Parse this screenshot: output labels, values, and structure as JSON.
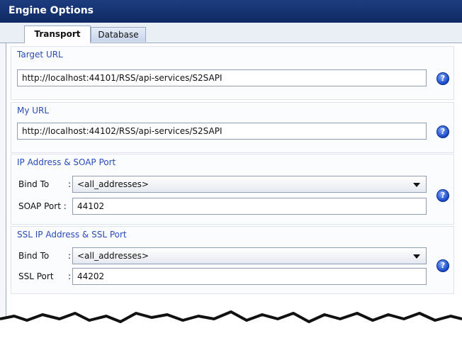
{
  "window": {
    "title": "Engine Options"
  },
  "tabs": [
    {
      "label": "Transport",
      "active": true
    },
    {
      "label": "Database",
      "active": false
    }
  ],
  "groups": {
    "target": {
      "label": "Target URL",
      "url_value": "http://localhost:44101/RSS/api-services/S2SAPI"
    },
    "my": {
      "label": "My URL",
      "url_value": "http://localhost:44102/RSS/api-services/S2SAPI"
    },
    "ip": {
      "label": "IP Address & SOAP Port",
      "bind_label": "Bind To",
      "bind_sep": ":",
      "bind_value": "<all_addresses>",
      "port_label": "SOAP Port :",
      "port_value": "44102"
    },
    "ssl": {
      "label": "SSL IP Address & SSL Port",
      "bind_label": "Bind To",
      "bind_sep": ":",
      "bind_value": "<all_addresses>",
      "port_label": "SSL Port",
      "port_sep": ":",
      "port_value": "44202"
    }
  },
  "help_icon_glyph": "?",
  "colors": {
    "titlebar": "#0f2a62",
    "group_label": "#2a4bb8",
    "help_icon": "#1847c6"
  }
}
